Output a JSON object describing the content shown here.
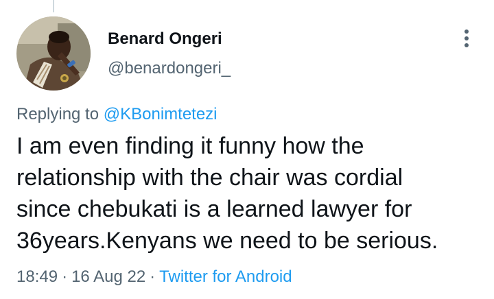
{
  "author": {
    "name": "Benard Ongeri",
    "handle": "@benardongeri_"
  },
  "reply": {
    "prefix": "Replying to",
    "mention": "@KBonimtetezi"
  },
  "tweet": {
    "lines": [
      "I am even finding it funny how the",
      "relationship with the chair was cordial",
      "since chebukati is a learned lawyer for",
      "36years.Kenyans we need to be serious."
    ]
  },
  "meta": {
    "time": "18:49",
    "separator": "·",
    "date": "16 Aug 22",
    "source": "Twitter for Android"
  },
  "icons": {
    "more": "more-vertical-icon"
  },
  "colors": {
    "link": "#1d9bf0",
    "secondary_text": "#536471",
    "primary_text": "#0f1419"
  }
}
